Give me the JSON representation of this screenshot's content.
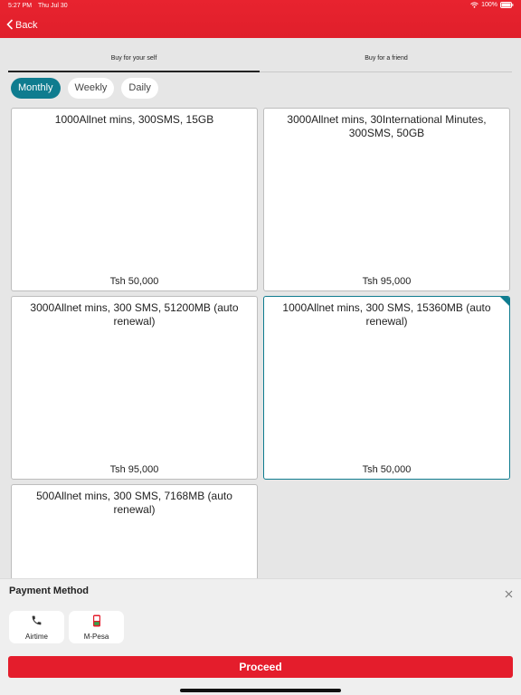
{
  "status_bar": {
    "time": "5:27 PM",
    "date": "Thu Jul 30",
    "battery": "100%"
  },
  "header": {
    "back_label": "Back"
  },
  "tabs": [
    {
      "label": "Buy for your self",
      "active": true
    },
    {
      "label": "Buy for a friend",
      "active": false
    }
  ],
  "periods": [
    {
      "label": "Monthly",
      "active": true
    },
    {
      "label": "Weekly",
      "active": false
    },
    {
      "label": "Daily",
      "active": false
    }
  ],
  "bundles": [
    {
      "title": "1000Allnet mins, 300SMS, 15GB",
      "price": "Tsh  50,000",
      "selected": false
    },
    {
      "title": "3000Allnet mins, 30International Minutes, 300SMS, 50GB",
      "price": "Tsh  95,000",
      "selected": false
    },
    {
      "title": "3000Allnet mins, 300 SMS, 51200MB (auto renewal)",
      "price": "Tsh  95,000",
      "selected": false
    },
    {
      "title": "1000Allnet mins, 300 SMS, 15360MB (auto renewal)",
      "price": "Tsh  50,000",
      "selected": true
    },
    {
      "title": "500Allnet mins, 300 SMS, 7168MB (auto renewal)",
      "price": "",
      "selected": false
    }
  ],
  "payment": {
    "title": "Payment Method",
    "options": [
      {
        "label": "Airtime",
        "icon": "phone-icon"
      },
      {
        "label": "M-Pesa",
        "icon": "mpesa-icon"
      }
    ],
    "proceed_label": "Proceed"
  },
  "colors": {
    "brand_red": "#e41d2c",
    "accent_teal": "#0f7c8f",
    "background": "#e6e6e6"
  }
}
